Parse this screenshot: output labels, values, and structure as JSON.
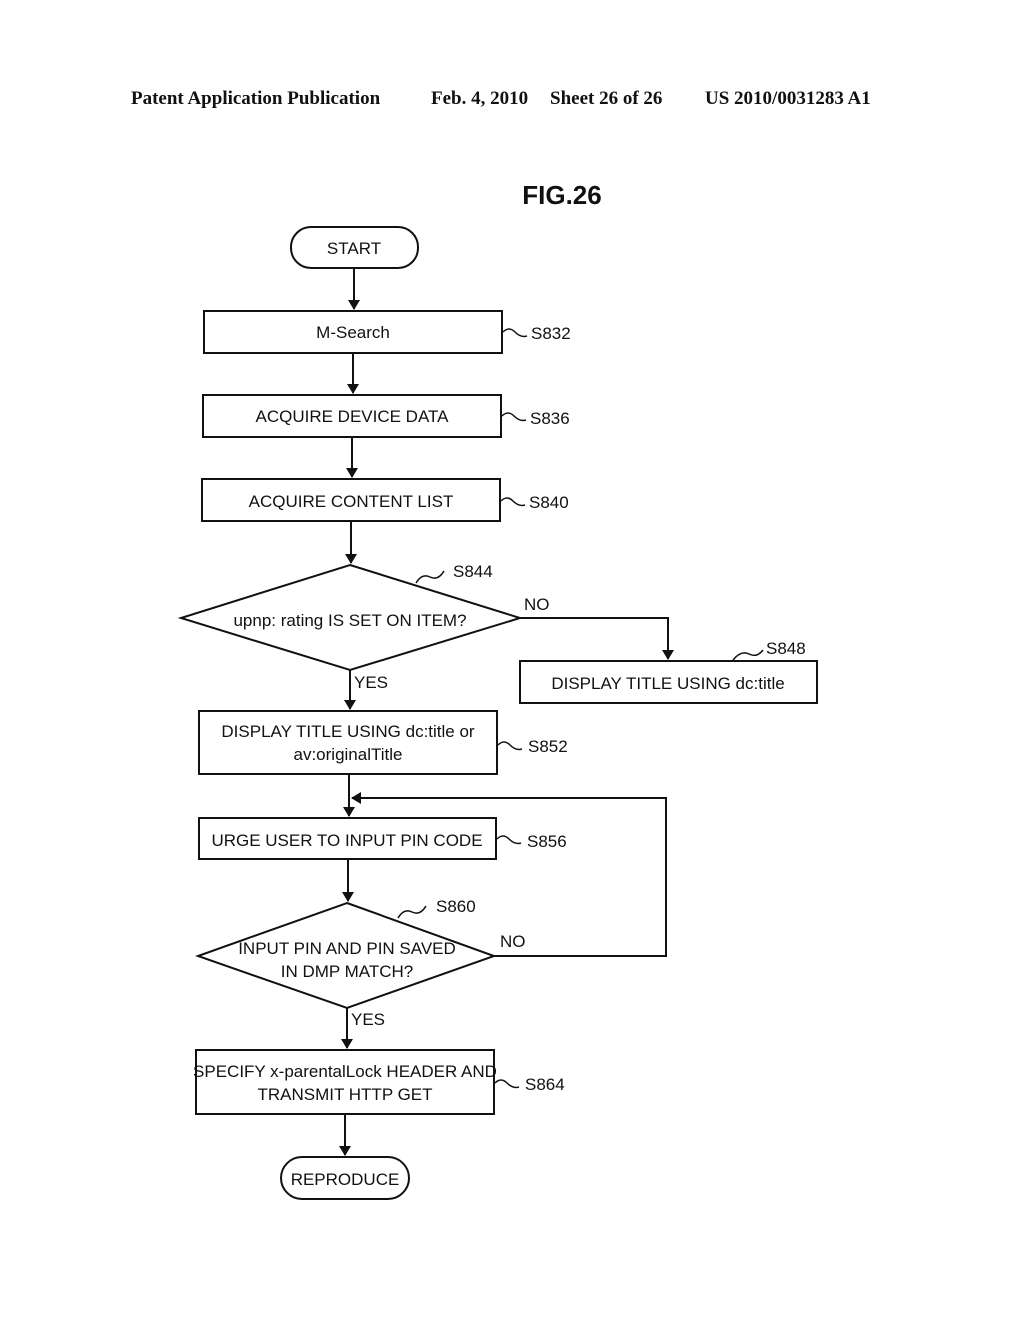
{
  "header": {
    "publication": "Patent Application Publication",
    "date": "Feb. 4, 2010",
    "sheet": "Sheet 26 of 26",
    "number": "US 2010/0031283 A1"
  },
  "figure": {
    "title": "FIG.26",
    "start": "START",
    "end": "REPRODUCE",
    "steps": [
      {
        "id": "S832",
        "lines": [
          "M-Search"
        ]
      },
      {
        "id": "S836",
        "lines": [
          "ACQUIRE DEVICE DATA"
        ]
      },
      {
        "id": "S840",
        "lines": [
          "ACQUIRE CONTENT LIST"
        ]
      },
      {
        "id": "S844",
        "lines": [
          "upnp: rating IS SET ON ITEM?"
        ],
        "type": "decision",
        "yes": "YES",
        "no": "NO"
      },
      {
        "id": "S848",
        "lines": [
          "DISPLAY TITLE USING dc:title"
        ]
      },
      {
        "id": "S852",
        "lines": [
          "DISPLAY TITLE USING dc:title or",
          "av:originalTitle"
        ]
      },
      {
        "id": "S856",
        "lines": [
          "URGE USER TO INPUT PIN CODE"
        ]
      },
      {
        "id": "S860",
        "lines": [
          "INPUT PIN AND PIN SAVED",
          "IN DMP MATCH?"
        ],
        "type": "decision",
        "yes": "YES",
        "no": "NO"
      },
      {
        "id": "S864",
        "lines": [
          "SPECIFY x-parentalLock HEADER AND",
          "TRANSMIT HTTP GET"
        ]
      }
    ]
  }
}
